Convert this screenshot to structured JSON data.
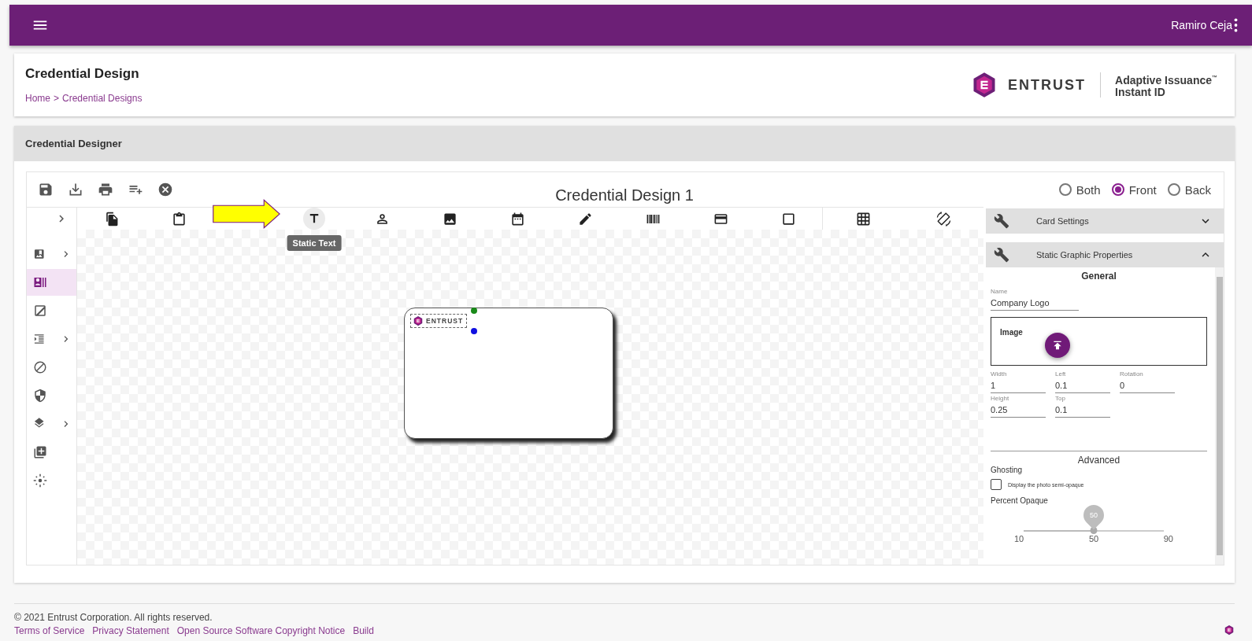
{
  "app_bar": {
    "user": "Ramiro Ceja"
  },
  "header": {
    "title": "Credential Design",
    "breadcrumb": [
      "Home",
      "Credential Designs"
    ],
    "separator": ">",
    "logo": {
      "wordmark": "ENTRUST",
      "product": [
        "Adaptive Issuance$^{™}$",
        "Instant ID"
      ]
    }
  },
  "section": {
    "title": "Credential Designer"
  },
  "design": {
    "title": "Credential Design 1",
    "sides": [
      {
        "label": "Both",
        "selected": false
      },
      {
        "label": "Front",
        "selected": true
      },
      {
        "label": "Back",
        "selected": false
      }
    ],
    "element_tools": [
      {
        "kind": "copy",
        "hovered": false
      },
      {
        "kind": "paste",
        "hovered": false
      },
      {
        "kind": "text",
        "hovered": true,
        "tooltip": "Static Text"
      },
      {
        "kind": "person",
        "hovered": false
      },
      {
        "kind": "image",
        "hovered": false
      },
      {
        "kind": "date",
        "hovered": false
      },
      {
        "kind": "pen",
        "hovered": false
      },
      {
        "kind": "barcode",
        "hovered": false
      },
      {
        "kind": "card",
        "hovered": false
      },
      {
        "kind": "square",
        "hovered": false
      },
      {
        "kind": "grid",
        "hovered": false
      },
      {
        "kind": "rotate",
        "hovered": false
      }
    ],
    "sidebar": [
      {
        "kind": "graphic",
        "expandable": true,
        "selected": false
      },
      {
        "kind": "idcard",
        "expandable": false,
        "selected": true
      },
      {
        "kind": "photo",
        "expandable": false,
        "selected": false
      },
      {
        "kind": "list",
        "expandable": true,
        "selected": false
      },
      {
        "kind": "block",
        "expandable": false,
        "selected": false
      },
      {
        "kind": "shield",
        "expandable": false,
        "selected": false
      },
      {
        "kind": "layers",
        "expandable": true,
        "selected": false
      },
      {
        "kind": "addbox",
        "expandable": false,
        "selected": false
      },
      {
        "kind": "focus",
        "expandable": false,
        "selected": false
      }
    ],
    "card": {
      "logo_text": "ENTRUST"
    }
  },
  "panels": [
    {
      "title": "Card Settings",
      "expanded": false
    },
    {
      "title": "Static Graphic Properties",
      "expanded": true
    }
  ],
  "properties": {
    "general": "General",
    "name": {
      "label": "Name",
      "value": "Company Logo"
    },
    "image": "Image",
    "fields": [
      {
        "label": "Width",
        "value": "1"
      },
      {
        "label": "Left",
        "value": "0.1"
      },
      {
        "label": "Rotation",
        "value": "0"
      },
      {
        "label": "Height",
        "value": "0.25"
      },
      {
        "label": "Top",
        "value": "0.1"
      }
    ],
    "advanced": "Advanced",
    "ghosting": "Ghosting",
    "checkbox": {
      "label": "Display the photo semi-opaque",
      "checked": false
    },
    "opacity": {
      "label": "Percent Opaque",
      "level": 0.5,
      "reading": "50",
      "ticks": [
        "10",
        "50",
        "90"
      ]
    }
  },
  "footer": {
    "copyright": "© 2021 Entrust Corporation. All rights reserved.",
    "links": [
      "Terms of Service",
      "Privacy Statement",
      "Open Source Software Copyright Notice",
      "Build"
    ]
  }
}
